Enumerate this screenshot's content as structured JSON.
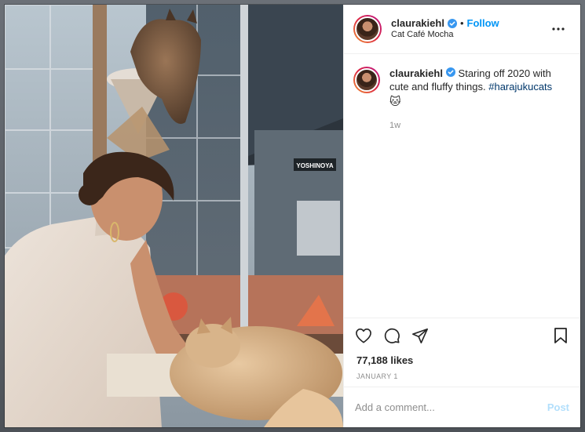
{
  "post": {
    "username": "claurakiehl",
    "separator": "•",
    "follow_label": "Follow",
    "location": "Cat Café Mocha",
    "more_icon": "more-horizontal-icon"
  },
  "caption": {
    "username": "claurakiehl",
    "text": " Staring off 2020 with cute and fluffy things. ",
    "hashtag": "#harajukucats",
    "emoji": "🐱",
    "time": "1w"
  },
  "actions": {
    "like_icon": "heart-icon",
    "comment_icon": "comment-icon",
    "share_icon": "share-icon",
    "save_icon": "bookmark-icon"
  },
  "stats": {
    "likes": "77,188 likes",
    "date": "JANUARY 1"
  },
  "composer": {
    "placeholder": "Add a comment...",
    "post_label": "Post"
  },
  "photo": {
    "sign_text": "YOSHINOYA"
  },
  "colors": {
    "accent": "#0095f6",
    "hashtag": "#00376b",
    "muted": "#8e8e8e",
    "post_disabled": "#b2dffc"
  }
}
